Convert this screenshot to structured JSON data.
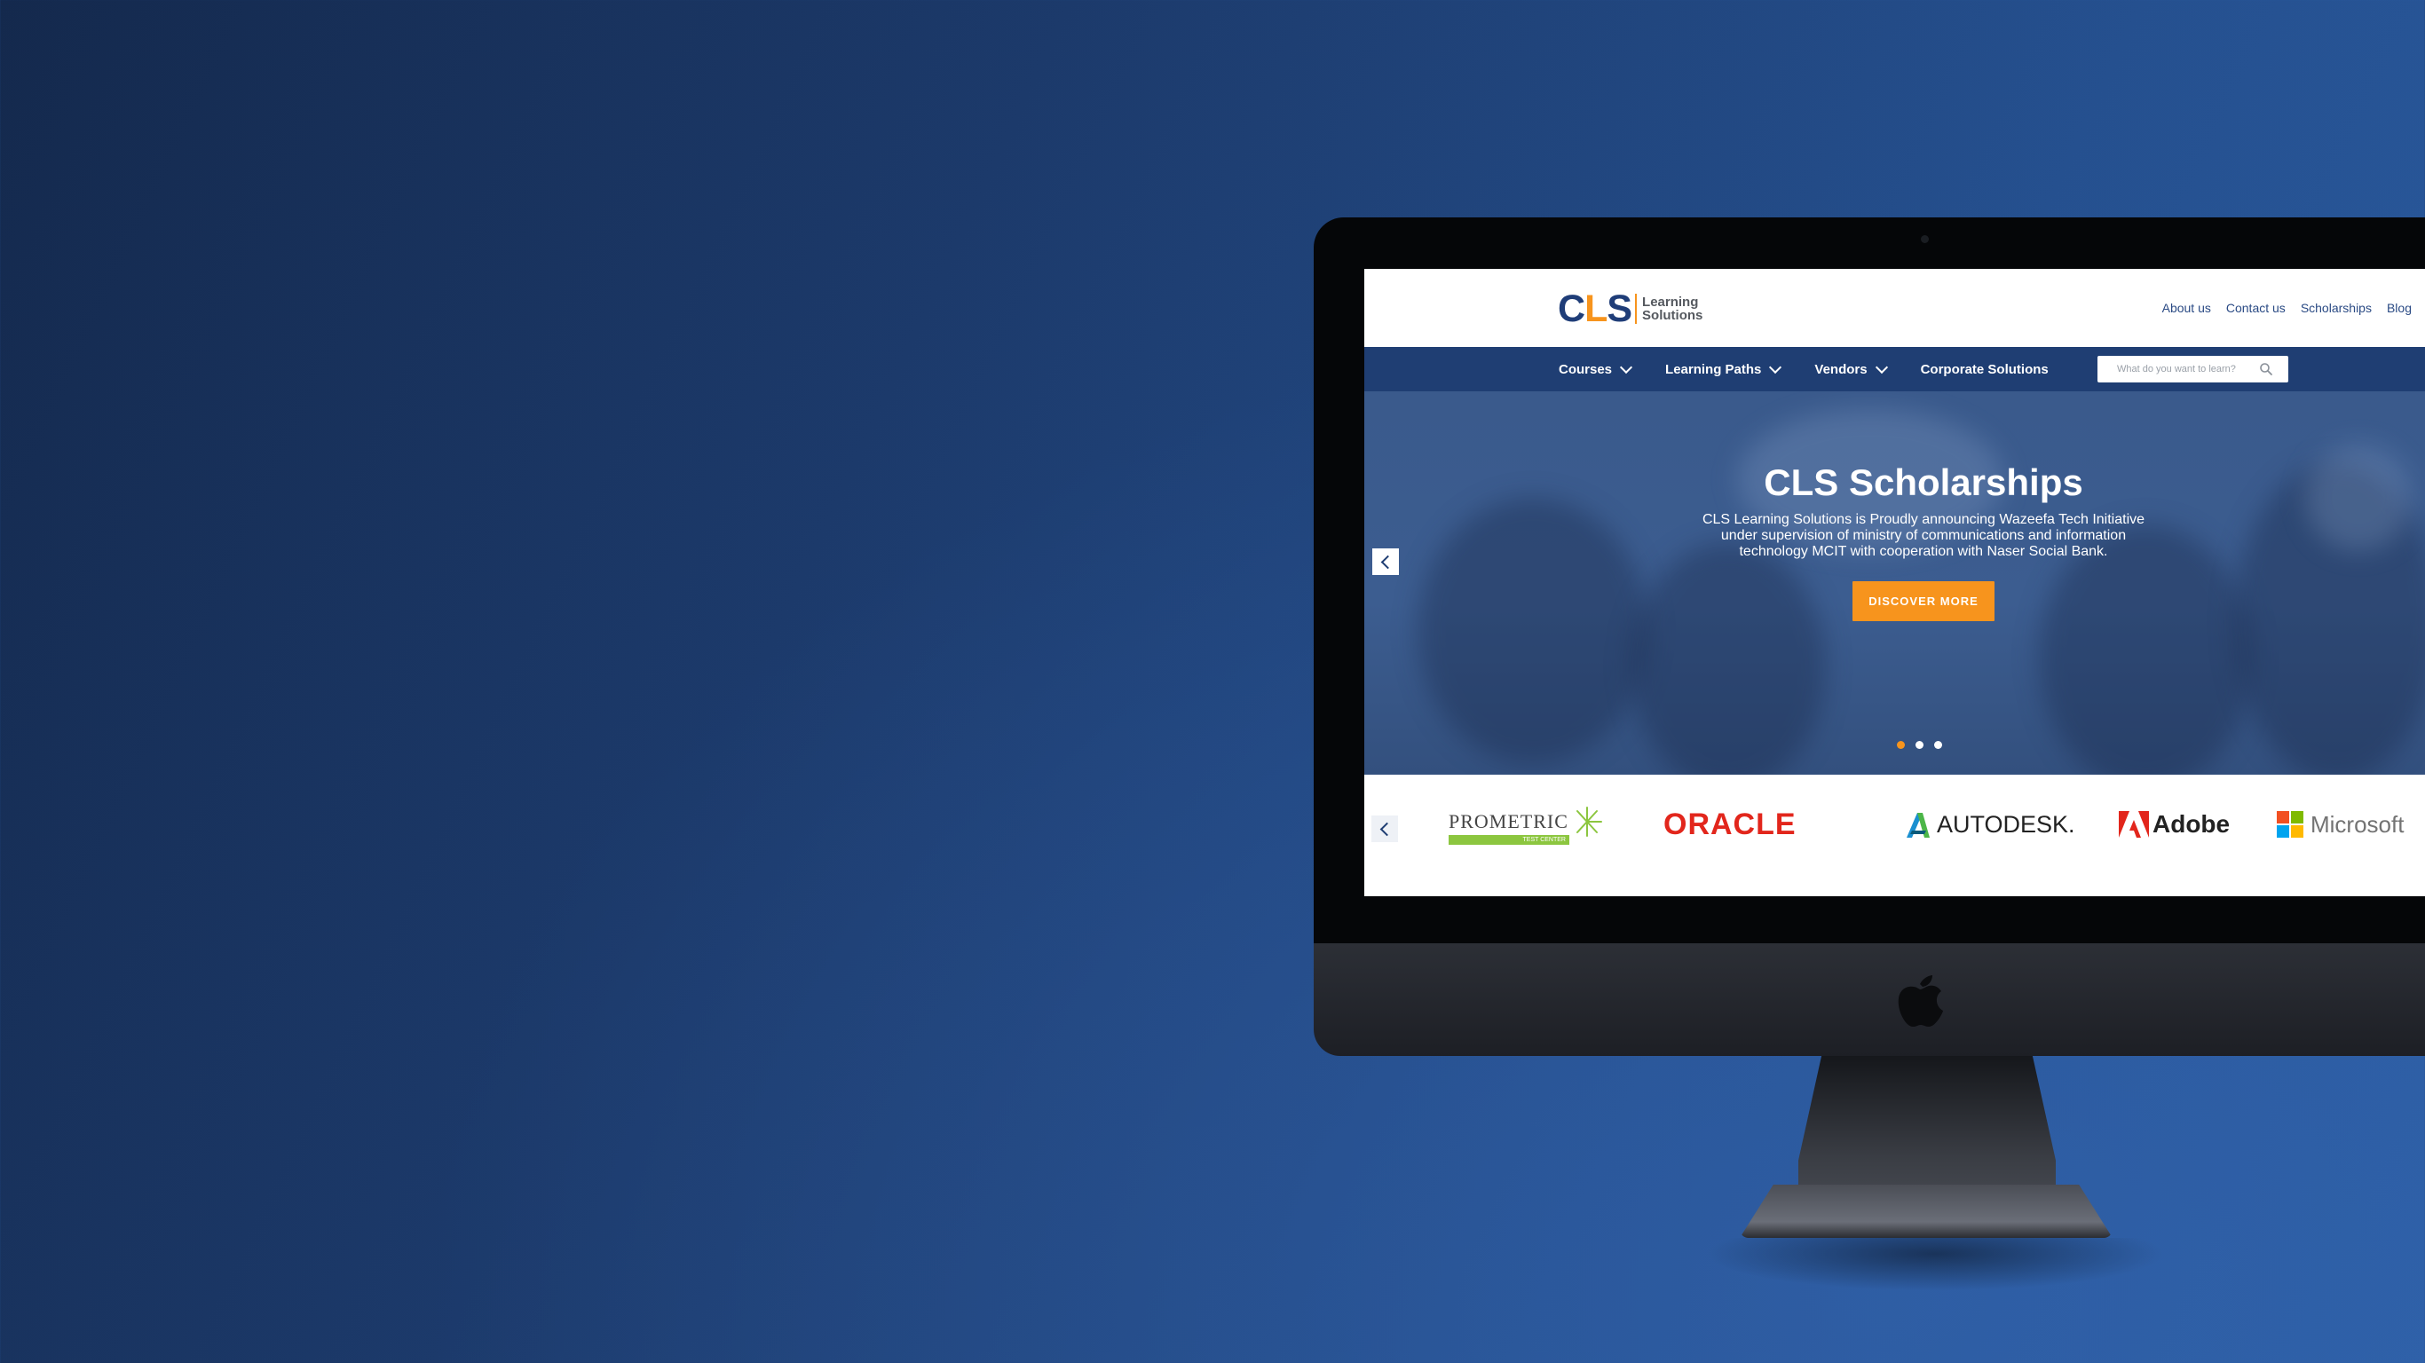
{
  "site": {
    "logo": {
      "mark_c": "C",
      "mark_l": "L",
      "mark_s": "S",
      "line1": "Learning",
      "line2": "Solutions"
    },
    "top_links": [
      "About us",
      "Contact us",
      "Scholarships",
      "Blog"
    ],
    "nav": [
      "Courses",
      "Learning Paths",
      "Vendors",
      "Corporate Solutions"
    ],
    "nav_has_dropdown": [
      true,
      true,
      true,
      false
    ],
    "search": {
      "placeholder": "What do you want to learn?",
      "icon": "search-icon"
    },
    "hero": {
      "title": "CLS Scholarships",
      "text": "CLS Learning Solutions is Proudly announcing Wazeefa Tech Initiative under supervision of ministry of communications and information technology MCIT with cooperation with Naser Social Bank.",
      "button": "DISCOVER MORE",
      "slide_count": 3,
      "active_slide": 1
    },
    "vendors": {
      "prometric": {
        "name": "PROMETRIC",
        "tag": "TEST CENTER"
      },
      "oracle": "ORACLE",
      "autodesk": "AUTODESK.",
      "adobe": "Adobe",
      "microsoft": "Microsoft"
    }
  },
  "colors": {
    "brand_blue": "#1f3e73",
    "brand_orange": "#f7941d",
    "oracle_red": "#e2261c",
    "prometric_green": "#8cc63f",
    "ms_red": "#f25022",
    "ms_green": "#7fba00",
    "ms_blue": "#00a4ef",
    "ms_yellow": "#ffb900"
  }
}
